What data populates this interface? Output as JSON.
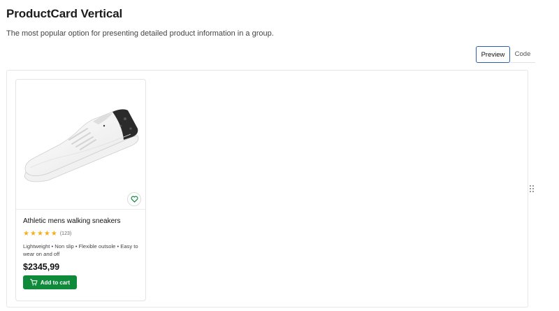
{
  "header": {
    "title": "ProductCard Vertical",
    "description": "The most popular option for presenting detailed product information in a group."
  },
  "tabs": [
    {
      "label": "Preview",
      "active": true
    },
    {
      "label": "Code",
      "active": false
    }
  ],
  "product": {
    "title": "Athletic mens walking sneakers",
    "rating_stars": 5,
    "rating_count": "(123)",
    "features": "Lightweight • Non slip • Flexible outsole • Easy to wear on and off",
    "price": "$2345,99",
    "add_to_cart_label": "Add to cart",
    "favorite_icon": "heart-icon",
    "cart_icon": "cart-icon"
  },
  "colors": {
    "accent": "#0f8a3a",
    "tab_active_border": "#2a5fb0",
    "star": "#f2b01e"
  }
}
